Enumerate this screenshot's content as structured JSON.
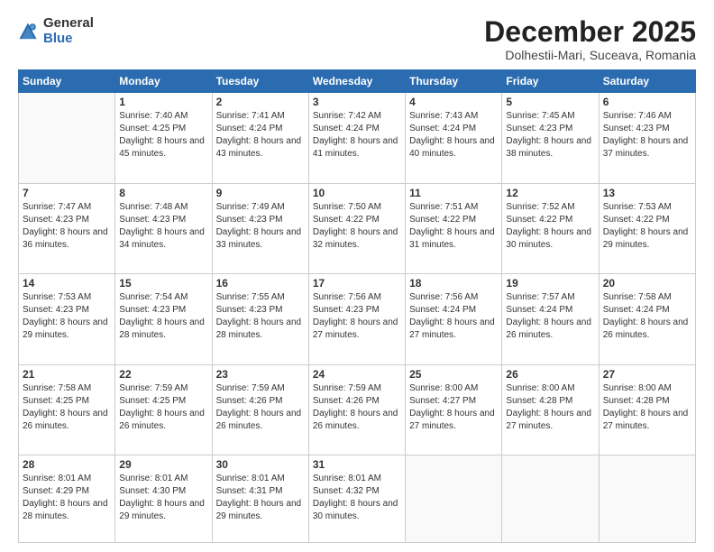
{
  "logo": {
    "general": "General",
    "blue": "Blue"
  },
  "header": {
    "month_year": "December 2025",
    "location": "Dolhestii-Mari, Suceava, Romania"
  },
  "weekdays": [
    "Sunday",
    "Monday",
    "Tuesday",
    "Wednesday",
    "Thursday",
    "Friday",
    "Saturday"
  ],
  "weeks": [
    [
      {
        "day": "",
        "sunrise": "",
        "sunset": "",
        "daylight": ""
      },
      {
        "day": "1",
        "sunrise": "Sunrise: 7:40 AM",
        "sunset": "Sunset: 4:25 PM",
        "daylight": "Daylight: 8 hours and 45 minutes."
      },
      {
        "day": "2",
        "sunrise": "Sunrise: 7:41 AM",
        "sunset": "Sunset: 4:24 PM",
        "daylight": "Daylight: 8 hours and 43 minutes."
      },
      {
        "day": "3",
        "sunrise": "Sunrise: 7:42 AM",
        "sunset": "Sunset: 4:24 PM",
        "daylight": "Daylight: 8 hours and 41 minutes."
      },
      {
        "day": "4",
        "sunrise": "Sunrise: 7:43 AM",
        "sunset": "Sunset: 4:24 PM",
        "daylight": "Daylight: 8 hours and 40 minutes."
      },
      {
        "day": "5",
        "sunrise": "Sunrise: 7:45 AM",
        "sunset": "Sunset: 4:23 PM",
        "daylight": "Daylight: 8 hours and 38 minutes."
      },
      {
        "day": "6",
        "sunrise": "Sunrise: 7:46 AM",
        "sunset": "Sunset: 4:23 PM",
        "daylight": "Daylight: 8 hours and 37 minutes."
      }
    ],
    [
      {
        "day": "7",
        "sunrise": "Sunrise: 7:47 AM",
        "sunset": "Sunset: 4:23 PM",
        "daylight": "Daylight: 8 hours and 36 minutes."
      },
      {
        "day": "8",
        "sunrise": "Sunrise: 7:48 AM",
        "sunset": "Sunset: 4:23 PM",
        "daylight": "Daylight: 8 hours and 34 minutes."
      },
      {
        "day": "9",
        "sunrise": "Sunrise: 7:49 AM",
        "sunset": "Sunset: 4:23 PM",
        "daylight": "Daylight: 8 hours and 33 minutes."
      },
      {
        "day": "10",
        "sunrise": "Sunrise: 7:50 AM",
        "sunset": "Sunset: 4:22 PM",
        "daylight": "Daylight: 8 hours and 32 minutes."
      },
      {
        "day": "11",
        "sunrise": "Sunrise: 7:51 AM",
        "sunset": "Sunset: 4:22 PM",
        "daylight": "Daylight: 8 hours and 31 minutes."
      },
      {
        "day": "12",
        "sunrise": "Sunrise: 7:52 AM",
        "sunset": "Sunset: 4:22 PM",
        "daylight": "Daylight: 8 hours and 30 minutes."
      },
      {
        "day": "13",
        "sunrise": "Sunrise: 7:53 AM",
        "sunset": "Sunset: 4:22 PM",
        "daylight": "Daylight: 8 hours and 29 minutes."
      }
    ],
    [
      {
        "day": "14",
        "sunrise": "Sunrise: 7:53 AM",
        "sunset": "Sunset: 4:23 PM",
        "daylight": "Daylight: 8 hours and 29 minutes."
      },
      {
        "day": "15",
        "sunrise": "Sunrise: 7:54 AM",
        "sunset": "Sunset: 4:23 PM",
        "daylight": "Daylight: 8 hours and 28 minutes."
      },
      {
        "day": "16",
        "sunrise": "Sunrise: 7:55 AM",
        "sunset": "Sunset: 4:23 PM",
        "daylight": "Daylight: 8 hours and 28 minutes."
      },
      {
        "day": "17",
        "sunrise": "Sunrise: 7:56 AM",
        "sunset": "Sunset: 4:23 PM",
        "daylight": "Daylight: 8 hours and 27 minutes."
      },
      {
        "day": "18",
        "sunrise": "Sunrise: 7:56 AM",
        "sunset": "Sunset: 4:24 PM",
        "daylight": "Daylight: 8 hours and 27 minutes."
      },
      {
        "day": "19",
        "sunrise": "Sunrise: 7:57 AM",
        "sunset": "Sunset: 4:24 PM",
        "daylight": "Daylight: 8 hours and 26 minutes."
      },
      {
        "day": "20",
        "sunrise": "Sunrise: 7:58 AM",
        "sunset": "Sunset: 4:24 PM",
        "daylight": "Daylight: 8 hours and 26 minutes."
      }
    ],
    [
      {
        "day": "21",
        "sunrise": "Sunrise: 7:58 AM",
        "sunset": "Sunset: 4:25 PM",
        "daylight": "Daylight: 8 hours and 26 minutes."
      },
      {
        "day": "22",
        "sunrise": "Sunrise: 7:59 AM",
        "sunset": "Sunset: 4:25 PM",
        "daylight": "Daylight: 8 hours and 26 minutes."
      },
      {
        "day": "23",
        "sunrise": "Sunrise: 7:59 AM",
        "sunset": "Sunset: 4:26 PM",
        "daylight": "Daylight: 8 hours and 26 minutes."
      },
      {
        "day": "24",
        "sunrise": "Sunrise: 7:59 AM",
        "sunset": "Sunset: 4:26 PM",
        "daylight": "Daylight: 8 hours and 26 minutes."
      },
      {
        "day": "25",
        "sunrise": "Sunrise: 8:00 AM",
        "sunset": "Sunset: 4:27 PM",
        "daylight": "Daylight: 8 hours and 27 minutes."
      },
      {
        "day": "26",
        "sunrise": "Sunrise: 8:00 AM",
        "sunset": "Sunset: 4:28 PM",
        "daylight": "Daylight: 8 hours and 27 minutes."
      },
      {
        "day": "27",
        "sunrise": "Sunrise: 8:00 AM",
        "sunset": "Sunset: 4:28 PM",
        "daylight": "Daylight: 8 hours and 27 minutes."
      }
    ],
    [
      {
        "day": "28",
        "sunrise": "Sunrise: 8:01 AM",
        "sunset": "Sunset: 4:29 PM",
        "daylight": "Daylight: 8 hours and 28 minutes."
      },
      {
        "day": "29",
        "sunrise": "Sunrise: 8:01 AM",
        "sunset": "Sunset: 4:30 PM",
        "daylight": "Daylight: 8 hours and 29 minutes."
      },
      {
        "day": "30",
        "sunrise": "Sunrise: 8:01 AM",
        "sunset": "Sunset: 4:31 PM",
        "daylight": "Daylight: 8 hours and 29 minutes."
      },
      {
        "day": "31",
        "sunrise": "Sunrise: 8:01 AM",
        "sunset": "Sunset: 4:32 PM",
        "daylight": "Daylight: 8 hours and 30 minutes."
      },
      {
        "day": "",
        "sunrise": "",
        "sunset": "",
        "daylight": ""
      },
      {
        "day": "",
        "sunrise": "",
        "sunset": "",
        "daylight": ""
      },
      {
        "day": "",
        "sunrise": "",
        "sunset": "",
        "daylight": ""
      }
    ]
  ]
}
